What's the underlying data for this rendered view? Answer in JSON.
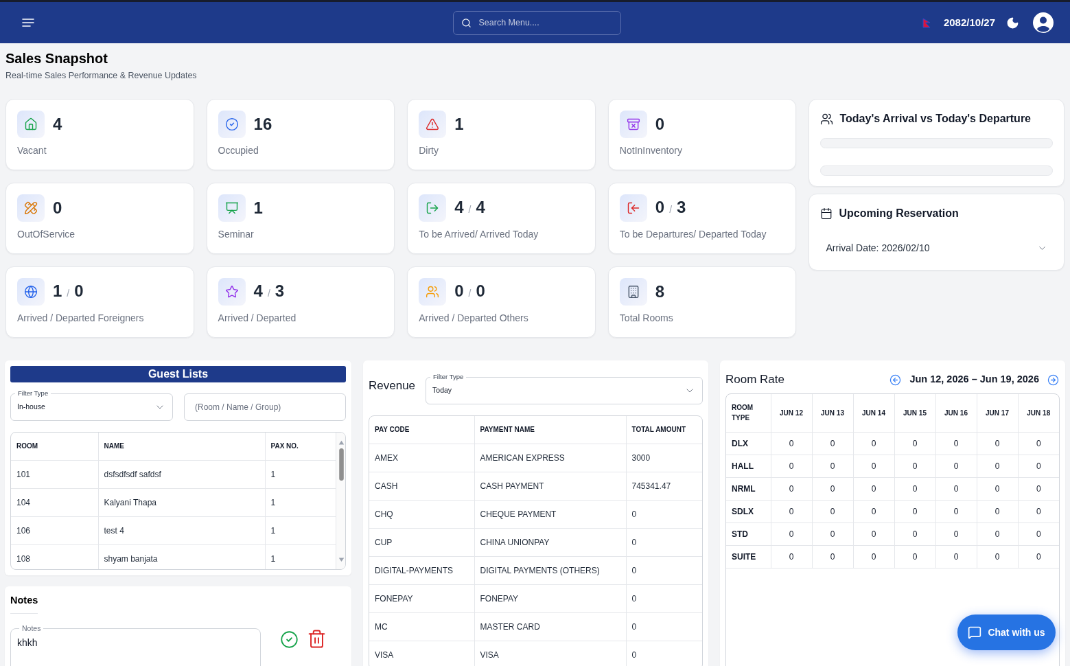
{
  "top_bar": {
    "search": {
      "placeholder": "Search Menu...."
    },
    "date": "2082/10/27"
  },
  "page_header": {
    "title": "Sales Snapshot",
    "subtitle": "Real-time Sales Performance & Revenue Updates"
  },
  "stat_cards": [
    {
      "kind": "single",
      "value": "4",
      "label": "Vacant"
    },
    {
      "kind": "single",
      "value": "16",
      "label": "Occupied"
    },
    {
      "kind": "single",
      "value": "1",
      "label": "Dirty"
    },
    {
      "kind": "single",
      "value": "0",
      "label": "NotInInventory"
    },
    {
      "kind": "single",
      "value": "0",
      "label": "OutOfService"
    },
    {
      "kind": "single",
      "value": "1",
      "label": "Seminar"
    },
    {
      "kind": "pair",
      "values": [
        "4",
        "4"
      ],
      "separator": "/",
      "label": "To be Arrived/ Arrived Today"
    },
    {
      "kind": "pair",
      "values": [
        "0",
        "3"
      ],
      "separator": "/",
      "label": "To be Departures/ Departed Today"
    },
    {
      "kind": "pair",
      "values": [
        "1",
        "0"
      ],
      "separator": "/",
      "label": "Arrived / Departed Foreigners"
    },
    {
      "kind": "pair",
      "values": [
        "4",
        "3"
      ],
      "separator": "/",
      "label": "Arrived / Departed"
    },
    {
      "kind": "pair",
      "values": [
        "0",
        "0"
      ],
      "separator": "/",
      "label": "Arrived / Departed Others"
    },
    {
      "kind": "single",
      "value": "8",
      "label": "Total Rooms"
    }
  ],
  "arrival_departure": {
    "title": "Today's Arrival vs Today's Departure"
  },
  "upcoming_reservation": {
    "title": "Upcoming Reservation",
    "items": [
      {
        "label": "Arrival Date: 2026/02/10",
        "expanded": false
      }
    ]
  },
  "guest_lists": {
    "title": "Guest Lists",
    "filter": {
      "label": "Filter Type",
      "value": "In-house"
    },
    "search": {
      "placeholder": "(Room / Name / Group)"
    },
    "table": {
      "columns": [
        "ROOM",
        "NAME",
        "PAX NO."
      ],
      "rows": [
        [
          "101",
          "dsfsdfsdf safdsf",
          "1"
        ],
        [
          "104",
          "Kalyani Thapa",
          "1"
        ],
        [
          "106",
          "test 4",
          "1"
        ],
        [
          "108",
          "shyam banjata",
          "1"
        ]
      ]
    }
  },
  "notes": {
    "title": "Notes",
    "field": {
      "label": "Notes",
      "value": "khkh"
    }
  },
  "revenue": {
    "title": "Revenue",
    "filter": {
      "label": "Filter Type",
      "value": "Today"
    },
    "table": {
      "columns": [
        "PAY CODE",
        "PAYMENT NAME",
        "TOTAL AMOUNT"
      ],
      "rows": [
        [
          "AMEX",
          "AMERICAN EXPRESS",
          "3000"
        ],
        [
          "CASH",
          "CASH PAYMENT",
          "745341.47"
        ],
        [
          "CHQ",
          "CHEQUE PAYMENT",
          "0"
        ],
        [
          "CUP",
          "CHINA UNIONPAY",
          "0"
        ],
        [
          "DIGITAL-PAYMENTS",
          "DIGITAL PAYMENTS (OTHERS)",
          "0"
        ],
        [
          "FONEPAY",
          "FONEPAY",
          "0"
        ],
        [
          "MC",
          "MASTER CARD",
          "0"
        ],
        [
          "VISA",
          "VISA",
          "0"
        ]
      ]
    }
  },
  "room_rate": {
    "title": "Room Rate",
    "date_range": "Jun 12, 2026 – Jun 19, 2026",
    "table": {
      "columns": [
        "ROOM TYPE",
        "JUN 12",
        "JUN 13",
        "JUN 14",
        "JUN 15",
        "JUN 16",
        "JUN 17",
        "JUN 18"
      ],
      "rows": [
        [
          "DLX",
          "0",
          "0",
          "0",
          "0",
          "0",
          "0",
          "0"
        ],
        [
          "HALL",
          "0",
          "0",
          "0",
          "0",
          "0",
          "0",
          "0"
        ],
        [
          "NRML",
          "0",
          "0",
          "0",
          "0",
          "0",
          "0",
          "0"
        ],
        [
          "SDLX",
          "0",
          "0",
          "0",
          "0",
          "0",
          "0",
          "0"
        ],
        [
          "STD",
          "0",
          "0",
          "0",
          "0",
          "0",
          "0",
          "0"
        ],
        [
          "SUITE",
          "0",
          "0",
          "0",
          "0",
          "0",
          "0",
          "0"
        ]
      ]
    }
  },
  "chat_button": {
    "label": "Chat with us"
  }
}
